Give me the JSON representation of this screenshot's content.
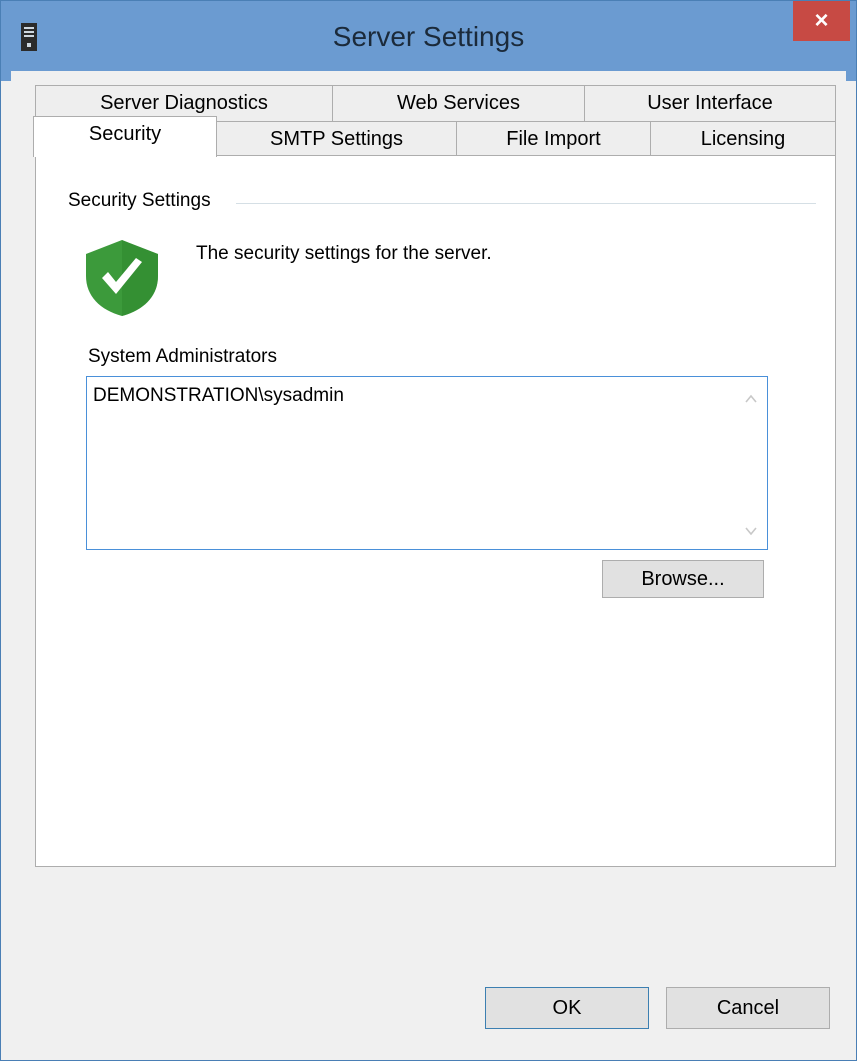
{
  "window": {
    "title": "Server Settings",
    "close_glyph": "×"
  },
  "tabs": {
    "row_back": [
      {
        "label": "Server Diagnostics"
      },
      {
        "label": "Web Services"
      },
      {
        "label": "User Interface"
      }
    ],
    "row_front": [
      {
        "label": "Security",
        "active": true
      },
      {
        "label": "SMTP Settings"
      },
      {
        "label": "File Import"
      },
      {
        "label": "Licensing"
      }
    ]
  },
  "security": {
    "group_label": "Security Settings",
    "description": "The security settings for the server.",
    "shield_icon": "shield-check-icon",
    "list_label": "System Administrators",
    "administrators": [
      "DEMONSTRATION\\sysadmin"
    ],
    "browse_label": "Browse..."
  },
  "footer": {
    "ok_label": "OK",
    "cancel_label": "Cancel"
  },
  "colors": {
    "titlebar": "#6b9bd1",
    "close_button": "#c74a44",
    "shield_green": "#3c9a3b",
    "focus_border": "#4a90d9"
  }
}
